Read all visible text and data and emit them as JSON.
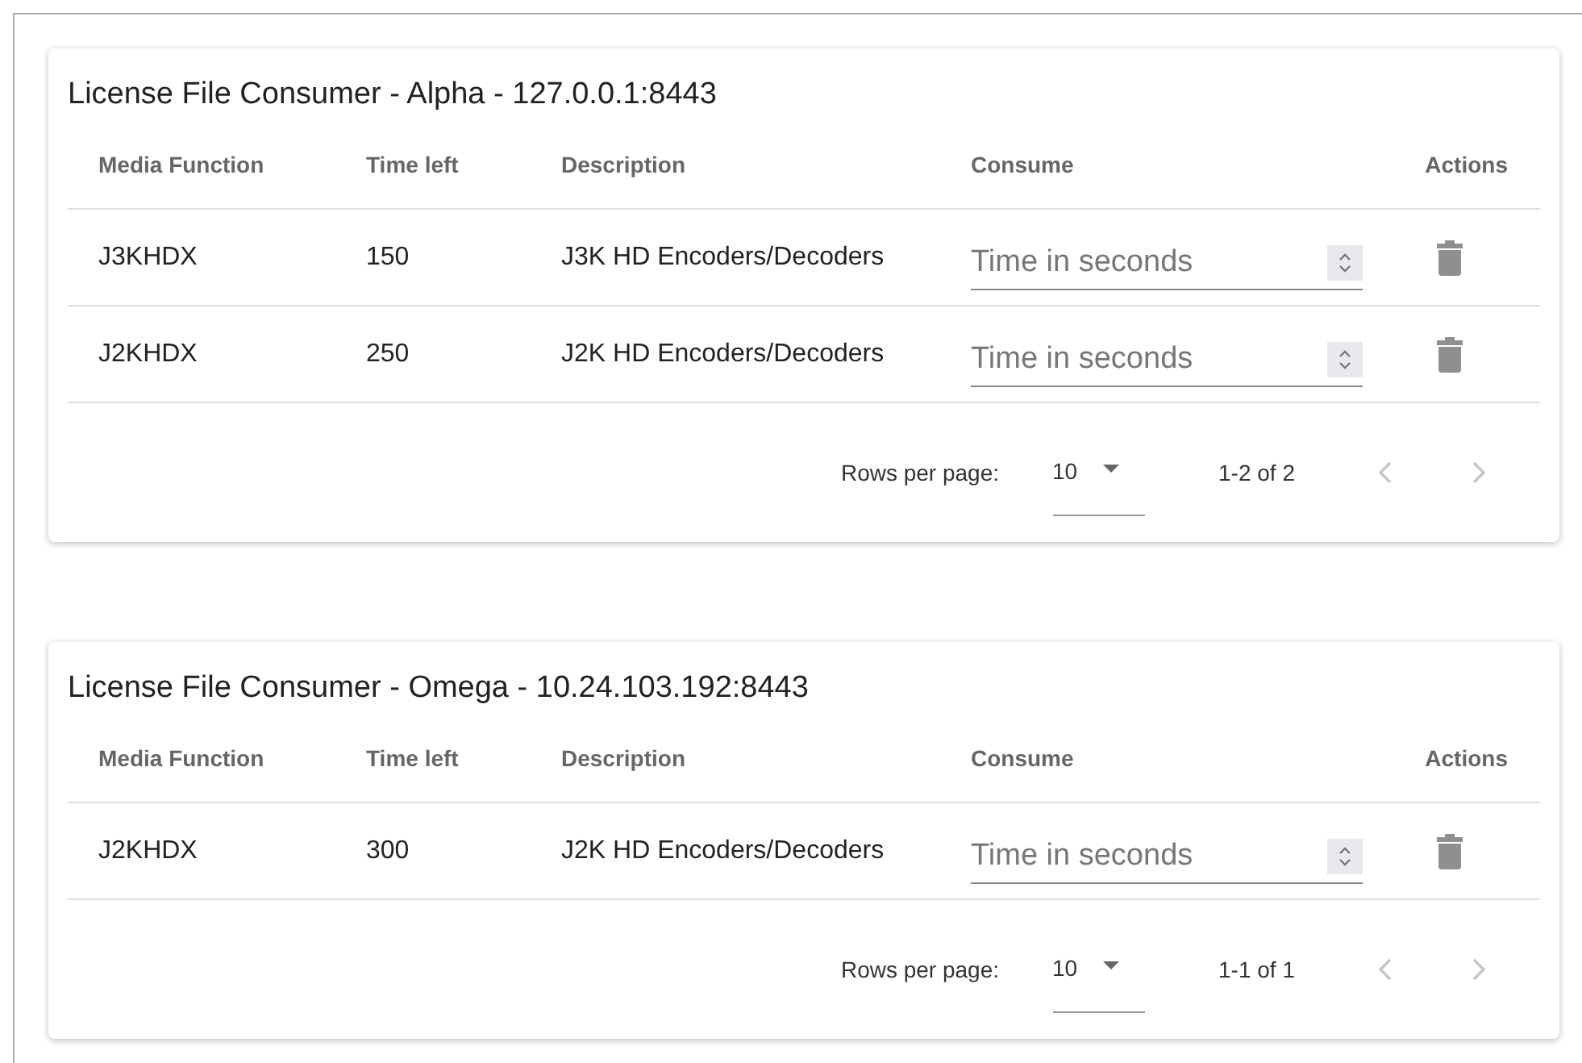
{
  "panels": [
    {
      "title": "License File Consumer - Alpha - 127.0.0.1:8443",
      "columns": [
        "Media Function",
        "Time left",
        "Description",
        "Consume",
        "Actions"
      ],
      "rows": [
        {
          "media_function": "J3KHDX",
          "time_left": "150",
          "description": "J3K HD Encoders/Decoders",
          "consume_placeholder": "Time in seconds"
        },
        {
          "media_function": "J2KHDX",
          "time_left": "250",
          "description": "J2K HD Encoders/Decoders",
          "consume_placeholder": "Time in seconds"
        }
      ],
      "pagination": {
        "rows_per_page_label": "Rows per page:",
        "rows_per_page": "10",
        "range": "1-2 of 2",
        "prev_disabled": true,
        "next_disabled": true
      }
    },
    {
      "title": "License File Consumer - Omega - 10.24.103.192:8443",
      "columns": [
        "Media Function",
        "Time left",
        "Description",
        "Consume",
        "Actions"
      ],
      "rows": [
        {
          "media_function": "J2KHDX",
          "time_left": "300",
          "description": "J2K HD Encoders/Decoders",
          "consume_placeholder": "Time in seconds"
        }
      ],
      "pagination": {
        "rows_per_page_label": "Rows per page:",
        "rows_per_page": "10",
        "range": "1-1 of 1",
        "prev_disabled": true,
        "next_disabled": true
      }
    }
  ]
}
